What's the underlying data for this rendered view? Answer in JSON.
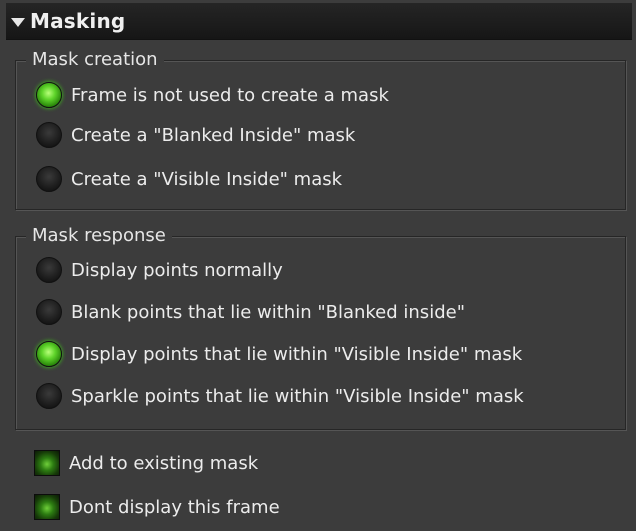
{
  "panel": {
    "title": "Masking"
  },
  "mask_creation": {
    "legend": "Mask creation",
    "options": [
      {
        "label": "Frame is not used to create a mask",
        "selected": true
      },
      {
        "label": "Create a \"Blanked Inside\" mask",
        "selected": false
      },
      {
        "label": "Create a \"Visible Inside\" mask",
        "selected": false
      }
    ]
  },
  "mask_response": {
    "legend": "Mask response",
    "options": [
      {
        "label": "Display points normally",
        "selected": false
      },
      {
        "label": "Blank points that lie within \"Blanked inside\"",
        "selected": false
      },
      {
        "label": "Display points that lie within \"Visible Inside\" mask",
        "selected": true
      },
      {
        "label": "Sparkle points that lie within \"Visible Inside\" mask",
        "selected": false
      }
    ]
  },
  "checkboxes": [
    {
      "label": "Add to existing mask",
      "checked": true
    },
    {
      "label": "Dont display this frame",
      "checked": true
    }
  ],
  "colors": {
    "background": "#3c3c3c",
    "header": "#1e1e1e",
    "active_green": "#5ed42a",
    "text": "#ececec"
  }
}
